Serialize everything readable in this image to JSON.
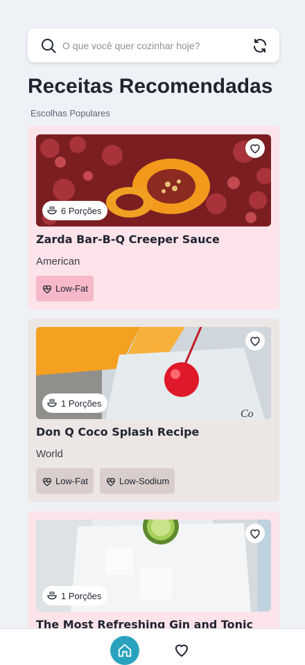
{
  "search": {
    "placeholder": "O que você quer cozinhar hoje?",
    "icon": "search-icon",
    "refresh_icon": "refresh-icon"
  },
  "header": {
    "title": "Receitas Recomendadas",
    "subtitle": "Escolhas Populares"
  },
  "recipes": [
    {
      "title": "Zarda Bar-B-Q Creeper Sauce",
      "cuisine": "American",
      "servings": "6 Porções",
      "tags": [
        "Low-Fat"
      ],
      "card_color": "#fde3ea",
      "image": "peppers-photo"
    },
    {
      "title": "Don Q Coco Splash Recipe",
      "cuisine": "World",
      "servings": "1 Porções",
      "tags": [
        "Low-Fat",
        "Low-Sodium"
      ],
      "card_color": "#ece6e4",
      "image": "cherry-drink-photo"
    },
    {
      "title": "The Most Refreshing Gin and Tonic",
      "cuisine": "",
      "servings": "1 Porções",
      "tags": [],
      "card_color": "#fde3ea",
      "image": "gin-tonic-photo"
    }
  ],
  "nav": {
    "items": [
      "home-icon",
      "favorites-icon"
    ],
    "active_color": "#29a3bd"
  }
}
